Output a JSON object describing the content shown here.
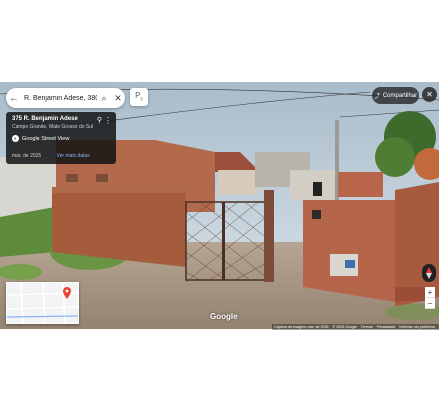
{
  "search": {
    "query": "R. Benjamin Adese, 380 - Jard"
  },
  "card": {
    "address": "375 R. Benjamin Adese",
    "city": "Campo Grande, Mato Grosso do Sul",
    "brand": "Google Street View",
    "date": "mar. de 2025",
    "more_dates": "Ver mais datas"
  },
  "share": {
    "label": "Compartilhar"
  },
  "logo": "Google",
  "footer": {
    "capture": "Captura da imagem: mar. de 2025",
    "copyright": "© 2025 Google",
    "terms": "Termos",
    "privacy": "Privacidade",
    "report": "Informar um problema"
  },
  "icons": {
    "back": "arrow-left-icon",
    "search": "search-icon",
    "close": "close-icon",
    "pegman": "pegman-icon",
    "share": "share-icon",
    "compass": "compass-icon",
    "more": "more-vert-icon",
    "pin": "pin-icon"
  },
  "colors": {
    "accent": "#8ab4f8",
    "map_pin": "#ea4335"
  }
}
